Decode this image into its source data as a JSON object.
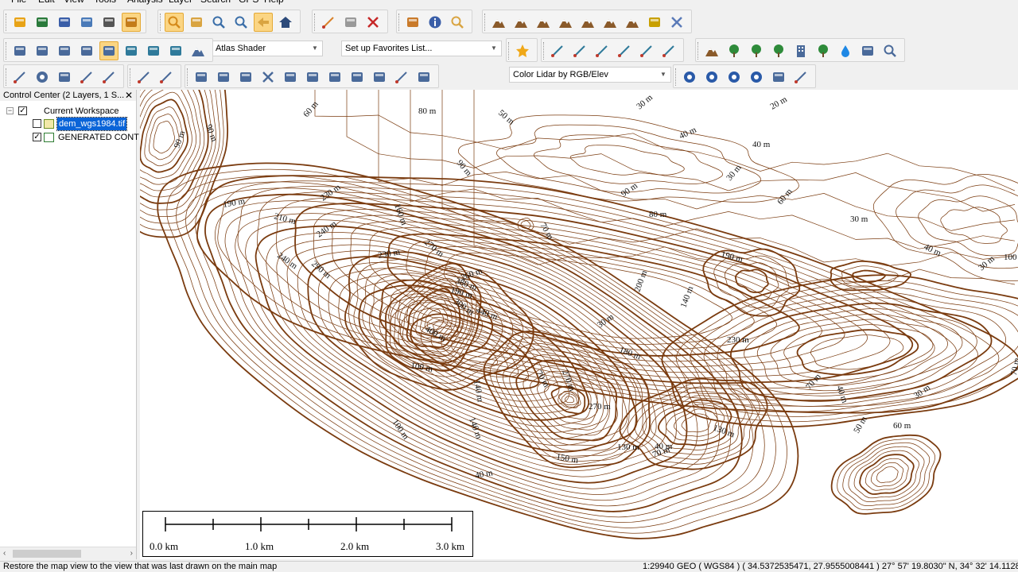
{
  "menu": [
    "File",
    "Edit",
    "View",
    "Tools",
    "Analysis",
    "Layer",
    "Search",
    "GPS",
    "Help"
  ],
  "toolbar": {
    "shader_select": "Atlas Shader",
    "favorites_select": "Set up Favorites List...",
    "lidar_select": "Color Lidar by RGB/Elev",
    "row1_icons": [
      "open-folder-icon",
      "globe-icon",
      "save-icon",
      "map-icon",
      "wrench-icon",
      "layers-icon",
      "zoom-tool-icon",
      "pan-hand-icon",
      "zoom-in-icon",
      "zoom-out-icon",
      "back-arrow-icon",
      "home-icon",
      "pencil-icon",
      "select-box-icon",
      "delete-icon",
      "measure-icon",
      "info-icon",
      "search-feature-icon",
      "terrain-1-icon",
      "terrain-2-icon",
      "terrain-3-icon",
      "terrain-4-icon",
      "terrain-5-icon",
      "terrain-6-icon",
      "terrain-7-icon",
      "image-icon",
      "close-tools-icon"
    ],
    "row2_icons": [
      "dock-icon",
      "pin-icon",
      "grid-icon",
      "view3d-icon",
      "percent-icon",
      "lidar-1-icon",
      "lidar-2-icon",
      "lidar-3-icon",
      "shader-icon",
      "favorite-star-icon",
      "line-1-icon",
      "line-2-icon",
      "line-3-icon",
      "line-4-icon",
      "line-5-icon",
      "line-6-icon",
      "mountain-icon",
      "grass-icon",
      "bush-icon",
      "tree-icon",
      "building-icon",
      "palm-icon",
      "water-drop-icon",
      "dots-icon",
      "magnify-icon"
    ],
    "row3_icons": [
      "digitize-1-icon",
      "target-icon",
      "ruler-grid-icon",
      "digitize-2-icon",
      "digitize-3-icon",
      "edit-1-icon",
      "edit-2-icon",
      "move-icon",
      "move-2-icon",
      "vertex-icon",
      "cross-icon",
      "cut-icon",
      "reshape-icon",
      "split-icon",
      "join-icon",
      "snap-icon",
      "grid-edit-icon",
      "measure-2-icon",
      "gear-1-icon",
      "gear-2-icon",
      "gear-3-icon",
      "gear-4-icon",
      "filter-icon",
      "edit-check-icon"
    ]
  },
  "panel": {
    "title": "Control Center (2 Layers, 1 S...",
    "workspace": "Current Workspace",
    "layers": [
      {
        "name": "dem_wgs1984.tif",
        "checked": false,
        "selected": true
      },
      {
        "name": "GENERATED CONT",
        "checked": true,
        "selected": false
      }
    ]
  },
  "map": {
    "contour_color": "#7a3b0f",
    "labels": [
      {
        "t": "60 m"
      },
      {
        "t": "80 m"
      },
      {
        "t": "50 m"
      },
      {
        "t": "30 m"
      },
      {
        "t": "20 m"
      },
      {
        "t": "90 m"
      },
      {
        "t": "40 m"
      },
      {
        "t": "40 m"
      },
      {
        "t": "90 m"
      },
      {
        "t": "90 m"
      },
      {
        "t": "30 m"
      },
      {
        "t": "90 m"
      },
      {
        "t": "80 m"
      },
      {
        "t": "60 m"
      },
      {
        "t": "30 m"
      },
      {
        "t": "190 m"
      },
      {
        "t": "210 m"
      },
      {
        "t": "230 m"
      },
      {
        "t": "160 m"
      },
      {
        "t": "70 m"
      },
      {
        "t": "240 m"
      },
      {
        "t": "270 m"
      },
      {
        "t": "290 m"
      },
      {
        "t": "240 m"
      },
      {
        "t": "230 m"
      },
      {
        "t": "260 m"
      },
      {
        "t": "380 m"
      },
      {
        "t": "190 m"
      },
      {
        "t": "100 m"
      },
      {
        "t": "40 m"
      },
      {
        "t": "30 m"
      },
      {
        "t": "190 m"
      },
      {
        "t": "300 m"
      },
      {
        "t": "440 m"
      },
      {
        "t": "200 m"
      },
      {
        "t": "400 m"
      },
      {
        "t": "140 m"
      },
      {
        "t": "30 m"
      },
      {
        "t": "230 m"
      },
      {
        "t": "180 m"
      },
      {
        "t": "100 m"
      },
      {
        "t": "140 m"
      },
      {
        "t": "270 m"
      },
      {
        "t": "270 m"
      },
      {
        "t": "140 m"
      },
      {
        "t": "70 m"
      },
      {
        "t": "70 m"
      },
      {
        "t": "40 m"
      },
      {
        "t": "70 m"
      },
      {
        "t": "100 m"
      },
      {
        "t": "130 m"
      },
      {
        "t": "30 m"
      },
      {
        "t": "60 m"
      },
      {
        "t": "50 m"
      },
      {
        "t": "150 m"
      },
      {
        "t": "130 m"
      },
      {
        "t": "70 m"
      },
      {
        "t": "40 m"
      },
      {
        "t": "40 m"
      }
    ]
  },
  "scalebar": {
    "labels": [
      "0.0 km",
      "1.0 km",
      "2.0 km",
      "3.0 km"
    ]
  },
  "status": {
    "message": "Restore the map view to the view that was last drawn on the main map",
    "info": "1:29940  GEO ( WGS84 ) ( 34.5372535471, 27.9555008441 )  27° 57' 19.8030\" N, 34° 32' 14.1128\" E"
  }
}
